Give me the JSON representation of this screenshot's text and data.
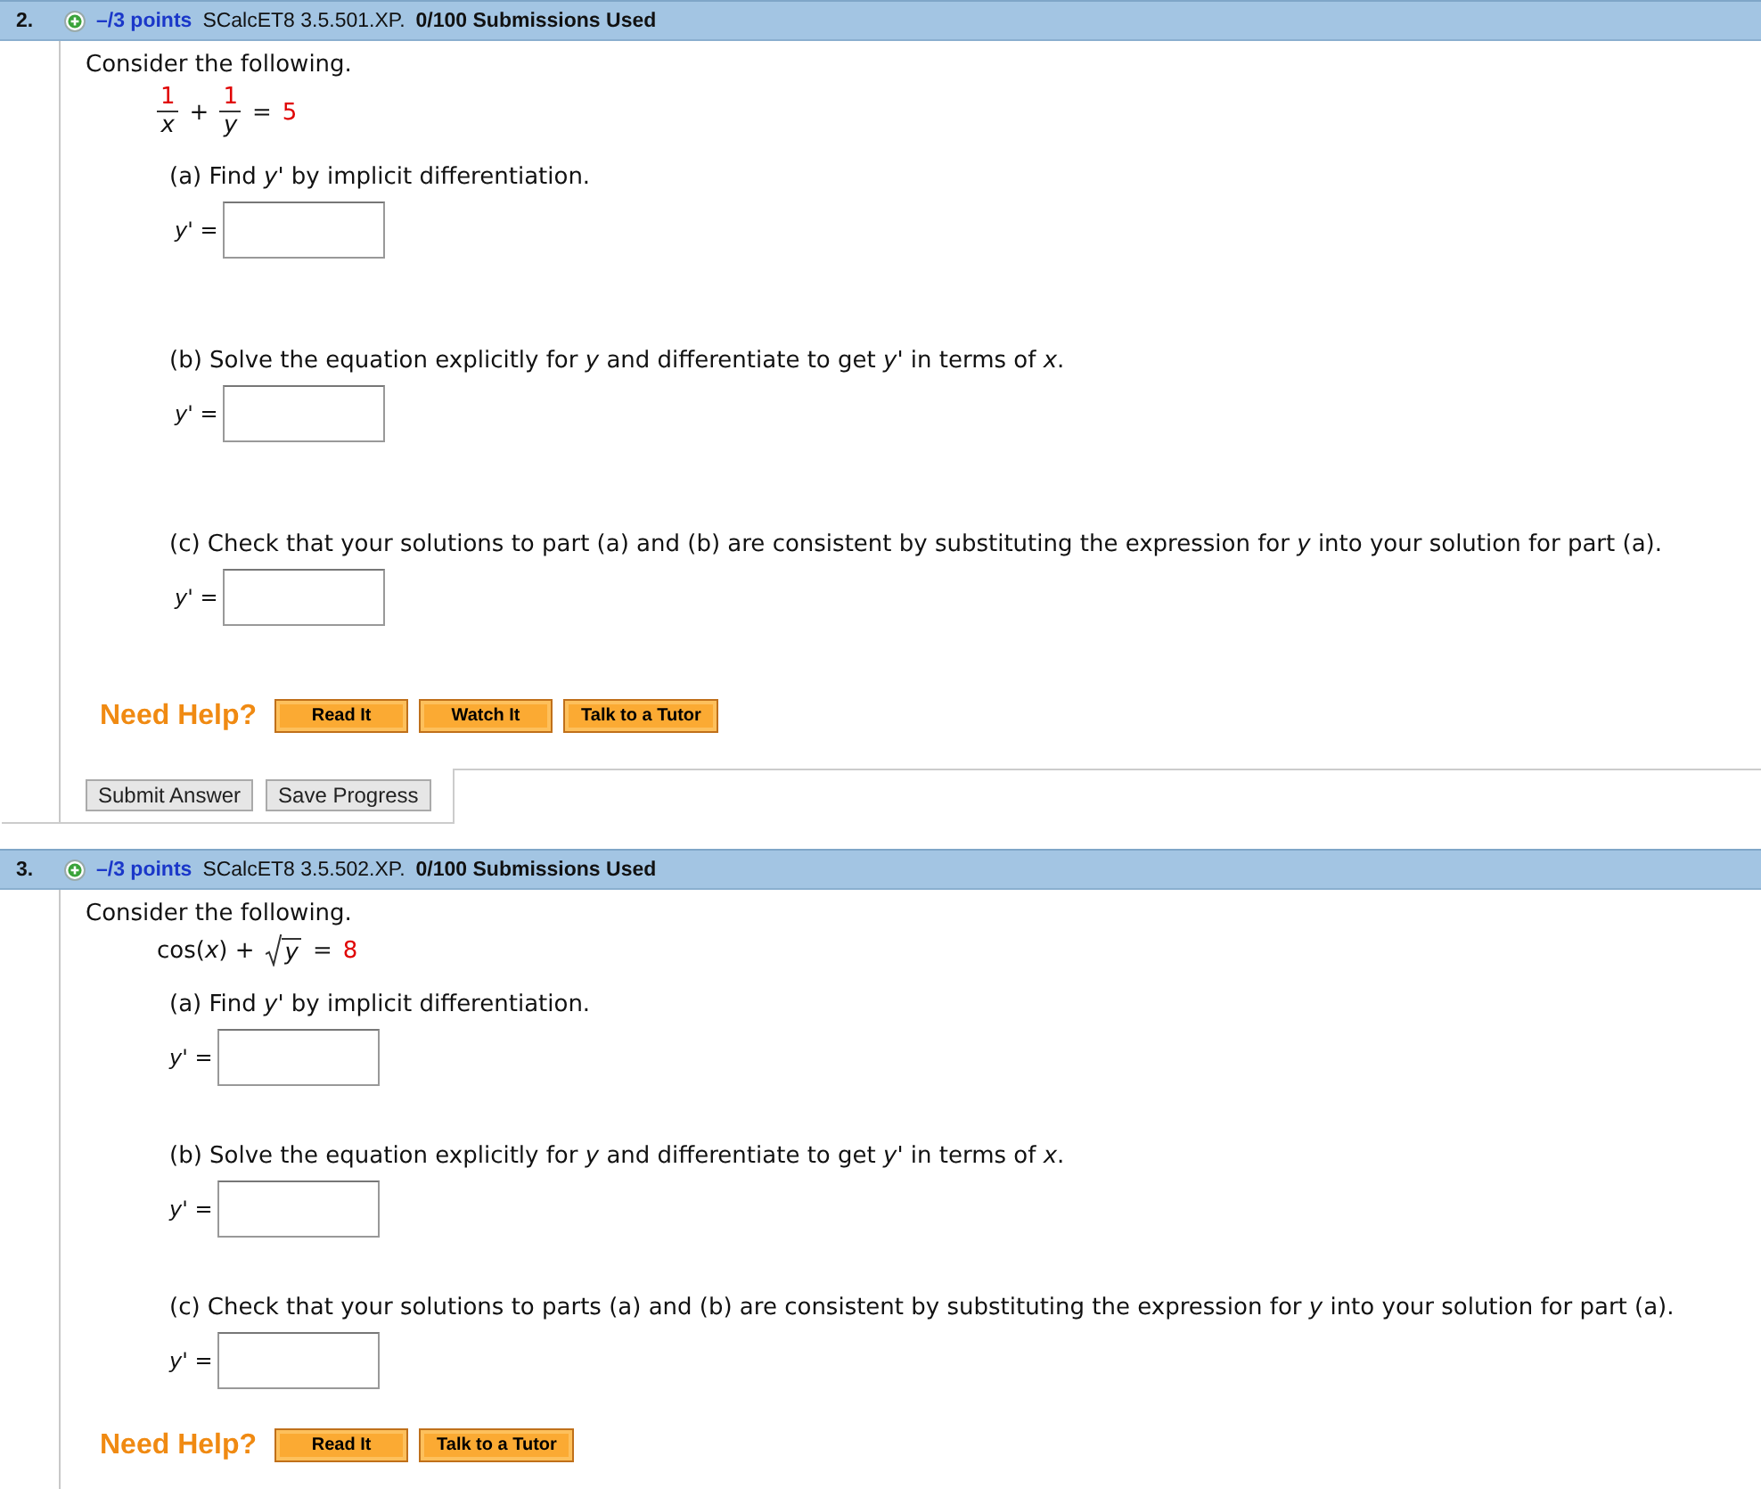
{
  "questions": [
    {
      "number": "2.",
      "points": "–/3 points",
      "code": "SCalcET8 3.5.501.XP.",
      "submissions": "0/100 Submissions Used",
      "prompt": "Consider the following.",
      "equation": [
        {
          "kind": "fraction",
          "numerator": "1",
          "denominator": "x"
        },
        {
          "kind": "text",
          "text": "+"
        },
        {
          "kind": "fraction",
          "numerator": "1",
          "denominator": "y"
        },
        {
          "kind": "text",
          "text": "="
        },
        {
          "kind": "value",
          "text": "5"
        }
      ],
      "parts": [
        {
          "text": "(a) Find *y*' by implicit differentiation.",
          "answer_label": "*y*' ="
        },
        {
          "text": "(b) Solve the equation explicitly for *y* and differentiate to get *y*' in terms of *x*.",
          "answer_label": "*y*' ="
        },
        {
          "text": "(c) Check that your solutions to part (a) and (b) are consistent by substituting the expression for *y* into your solution for part (a).",
          "answer_label": "*y*' ="
        }
      ],
      "help": {
        "label": "Need Help?",
        "buttons": [
          "Read It",
          "Watch It",
          "Talk to a Tutor"
        ]
      },
      "actions": [
        "Submit Answer",
        "Save Progress"
      ]
    },
    {
      "number": "3.",
      "points": "–/3 points",
      "code": "SCalcET8 3.5.502.XP.",
      "submissions": "0/100 Submissions Used",
      "prompt": "Consider the following.",
      "equation": [
        {
          "kind": "text",
          "text": "cos(*x*) +"
        },
        {
          "kind": "sqrt",
          "text": "y"
        },
        {
          "kind": "text",
          "text": "="
        },
        {
          "kind": "value",
          "text": "8"
        }
      ],
      "parts": [
        {
          "text": "(a) Find *y*' by implicit differentiation.",
          "answer_label": "*y*' ="
        },
        {
          "text": "(b) Solve the equation explicitly for *y* and differentiate to get *y*' in terms of *x*.",
          "answer_label": "*y*' ="
        },
        {
          "text": "(c) Check that your solutions to parts (a) and (b) are consistent by substituting the expression for *y* into your solution for part (a).",
          "answer_label": "*y*' ="
        }
      ],
      "help": {
        "label": "Need Help?",
        "buttons": [
          "Read It",
          "Talk to a Tutor"
        ]
      }
    }
  ]
}
